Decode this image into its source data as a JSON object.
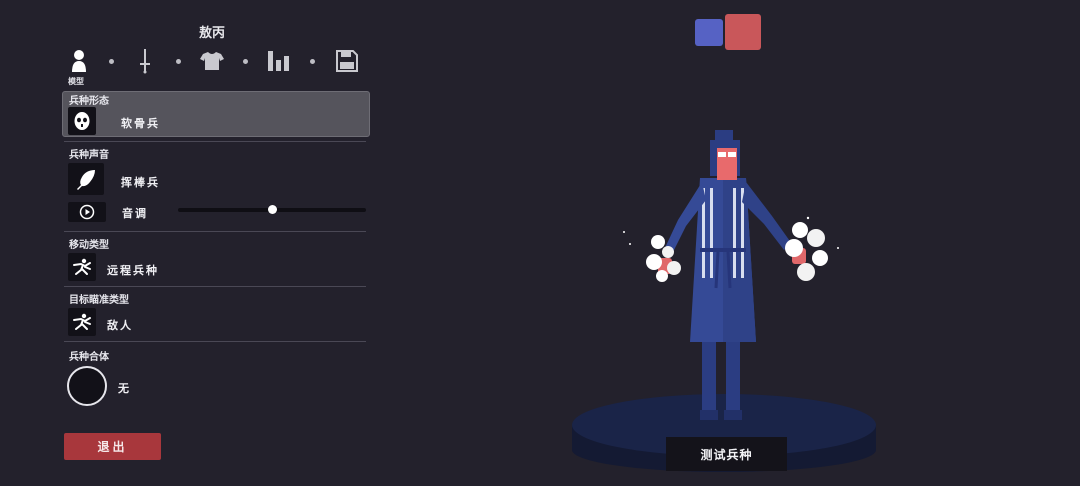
{
  "header": {
    "title": "敖丙"
  },
  "tabs": [
    {
      "icon": "person-icon",
      "label": "模型"
    },
    {
      "icon": "sword-icon"
    },
    {
      "icon": "shirt-icon"
    },
    {
      "icon": "stats-icon"
    },
    {
      "icon": "save-icon"
    }
  ],
  "sections": {
    "form": {
      "label": "兵种形态",
      "value": "软骨兵",
      "icon": "mask-icon"
    },
    "voice": {
      "label": "兵种声音",
      "value": "挥棒兵",
      "icon": "feather-icon",
      "pitch_label": "音调",
      "pitch_value": 0.5,
      "play_icon": "play-icon"
    },
    "movement": {
      "label": "移动类型",
      "value": "远程兵种",
      "icon": "running-figure-icon"
    },
    "targeting": {
      "label": "目标瞄准类型",
      "value": "敌人",
      "icon": "running-figure-icon"
    },
    "fusion": {
      "label": "兵种合体",
      "value": "无"
    }
  },
  "buttons": {
    "exit": "退出",
    "test": "测试兵种"
  },
  "team_colors": {
    "blue": "#5662c4",
    "red": "#c9575a"
  },
  "colors": {
    "background": "#23212c",
    "exit": "#a8373c"
  }
}
